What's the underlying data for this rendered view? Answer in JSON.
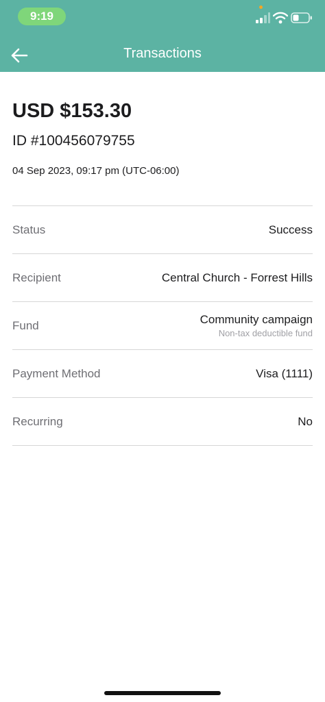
{
  "status_bar": {
    "time": "9:19",
    "icons": [
      "orange-dot",
      "signal-icon",
      "wifi-icon",
      "battery-icon"
    ]
  },
  "nav": {
    "title": "Transactions",
    "back_icon": "arrow-left-icon"
  },
  "colors": {
    "header": "#5cb3a3",
    "time_pill": "#7fd67a",
    "label": "#6e6e73",
    "divider": "#d6d6d6"
  },
  "transaction": {
    "amount": "USD $153.30",
    "id": "ID #100456079755",
    "date": "04 Sep 2023, 09:17 pm (UTC-06:00)"
  },
  "details": {
    "status": {
      "label": "Status",
      "value": "Success"
    },
    "recipient": {
      "label": "Recipient",
      "value": "Central Church - Forrest Hills"
    },
    "fund": {
      "label": "Fund",
      "value": "Community campaign",
      "sub": "Non-tax deductible fund"
    },
    "payment_method": {
      "label": "Payment Method",
      "value": "Visa (1111)"
    },
    "recurring": {
      "label": "Recurring",
      "value": "No"
    }
  }
}
